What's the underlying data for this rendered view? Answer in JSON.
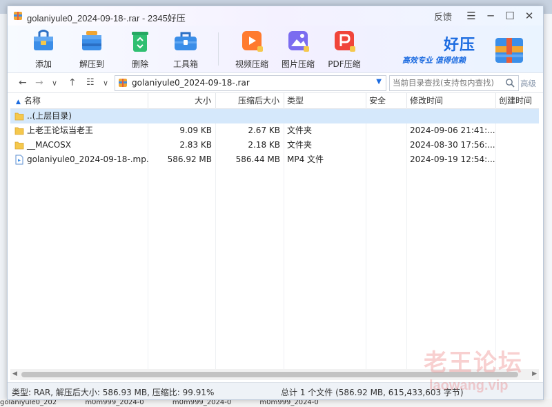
{
  "window": {
    "title": "golaniyule0_2024-09-18-.rar - 2345好压",
    "feedback_label": "反馈",
    "menu_glyph": "☰",
    "minimize_glyph": "─",
    "maximize_glyph": "☐",
    "close_glyph": "✕"
  },
  "toolbar": {
    "add_label": "添加",
    "extract_label": "解压到",
    "delete_label": "删除",
    "toolbox_label": "工具箱",
    "video_label": "视频压缩",
    "image_label": "图片压缩",
    "pdf_label": "PDF压缩"
  },
  "brand": {
    "name": "好压",
    "slogan": "高效专业 值得信赖"
  },
  "addressbar": {
    "back_glyph": "←",
    "forward_glyph": "→",
    "history_glyph": "∨",
    "up_glyph": "↑",
    "view_glyph": "☷",
    "view_dd_glyph": "∨",
    "path": "golaniyule0_2024-09-18-.rar",
    "search_placeholder": "当前目录查找(支持包内查找)",
    "advanced_label": "高级"
  },
  "columns": {
    "name": "名称",
    "size": "大小",
    "packed": "压缩后大小",
    "type": "类型",
    "security": "安全",
    "modified": "修改时间",
    "created": "创建时间"
  },
  "rows": [
    {
      "name": "..(上层目录)",
      "size": "",
      "packed": "",
      "type": "",
      "security": "",
      "modified": "",
      "kind": "folder",
      "selected": true
    },
    {
      "name": "上老王论坛当老王",
      "size": "9.09 KB",
      "packed": "2.67 KB",
      "type": "文件夹",
      "security": "",
      "modified": "2024-09-06 21:41:...",
      "kind": "folder",
      "selected": false
    },
    {
      "name": "__MACOSX",
      "size": "2.83 KB",
      "packed": "2.18 KB",
      "type": "文件夹",
      "security": "",
      "modified": "2024-08-30 17:56:...",
      "kind": "folder",
      "selected": false
    },
    {
      "name": "golaniyule0_2024-09-18-.mp...",
      "size": "586.92 MB",
      "packed": "586.44 MB",
      "type": "MP4 文件",
      "security": "",
      "modified": "2024-09-19 12:54:...",
      "kind": "video",
      "selected": false
    }
  ],
  "status": {
    "left": "类型: RAR, 解压后大小: 586.93 MB, 压缩比: 99.91%",
    "right": "总计 1 个文件 (586.92 MB, 615,433,603 字节)"
  },
  "watermark": {
    "line1": "老王论坛",
    "line2": "laowang.vip"
  },
  "background": {
    "bottom_items": [
      "golaniyule0_202",
      "m0m999_2024-0",
      "m0m999_2024-0",
      "m0m999_2024-0"
    ]
  },
  "colors": {
    "accent": "#1b6be0",
    "selected_row": "#d5e8fb",
    "folder": "#f5c84c"
  }
}
